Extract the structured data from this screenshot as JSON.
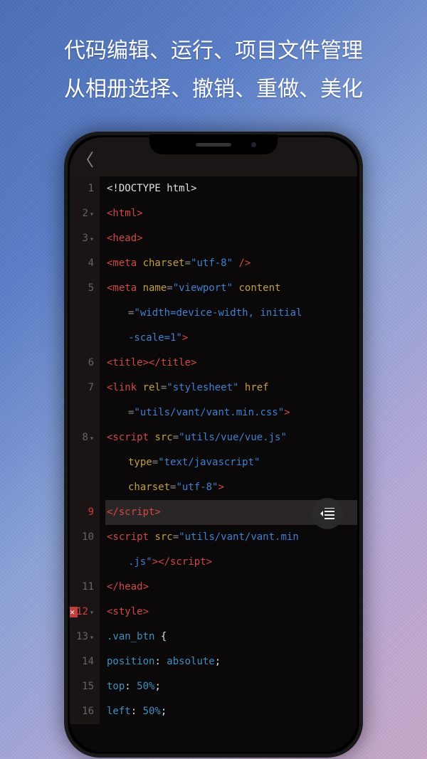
{
  "promo": {
    "line1": "代码编辑、运行、项目文件管理",
    "line2": "从相册选择、撤销、重做、美化"
  },
  "editor": {
    "lines": [
      {
        "num": "1",
        "fold": "",
        "error": false,
        "highlighted": false,
        "indent": 0,
        "tokens": [
          {
            "t": "<!DOCTYPE html>",
            "c": "white"
          }
        ]
      },
      {
        "num": "2",
        "fold": "▾",
        "error": false,
        "highlighted": false,
        "indent": 0,
        "tokens": [
          {
            "t": "<html>",
            "c": "tag"
          }
        ]
      },
      {
        "num": "3",
        "fold": "▾",
        "error": false,
        "highlighted": false,
        "indent": 0,
        "tokens": [
          {
            "t": "<head>",
            "c": "tag"
          }
        ]
      },
      {
        "num": "4",
        "fold": "",
        "error": false,
        "highlighted": false,
        "indent": 0,
        "tokens": [
          {
            "t": "<meta ",
            "c": "tag"
          },
          {
            "t": "charset",
            "c": "attr-name"
          },
          {
            "t": "=",
            "c": "punct"
          },
          {
            "t": "\"utf-8\"",
            "c": "attr-val"
          },
          {
            "t": " />",
            "c": "tag"
          }
        ]
      },
      {
        "num": "5",
        "fold": "",
        "error": false,
        "highlighted": false,
        "indent": 0,
        "tokens": [
          {
            "t": "<meta ",
            "c": "tag"
          },
          {
            "t": "name",
            "c": "attr-name"
          },
          {
            "t": "=",
            "c": "punct"
          },
          {
            "t": "\"viewport\"",
            "c": "attr-val"
          },
          {
            "t": " content",
            "c": "attr-name"
          }
        ]
      },
      {
        "num": "",
        "fold": "",
        "error": false,
        "highlighted": false,
        "indent": 1,
        "tokens": [
          {
            "t": "=",
            "c": "punct"
          },
          {
            "t": "\"width=device-width, initial",
            "c": "attr-val"
          }
        ]
      },
      {
        "num": "",
        "fold": "",
        "error": false,
        "highlighted": false,
        "indent": 1,
        "tokens": [
          {
            "t": "-scale=1\"",
            "c": "attr-val"
          },
          {
            "t": ">",
            "c": "tag"
          }
        ]
      },
      {
        "num": "6",
        "fold": "",
        "error": false,
        "highlighted": false,
        "indent": 0,
        "tokens": [
          {
            "t": "<title></title>",
            "c": "tag"
          }
        ]
      },
      {
        "num": "7",
        "fold": "",
        "error": false,
        "highlighted": false,
        "indent": 0,
        "tokens": [
          {
            "t": "<link ",
            "c": "tag"
          },
          {
            "t": "rel",
            "c": "attr-name"
          },
          {
            "t": "=",
            "c": "punct"
          },
          {
            "t": "\"stylesheet\"",
            "c": "attr-val"
          },
          {
            "t": " href",
            "c": "attr-name"
          }
        ]
      },
      {
        "num": "",
        "fold": "",
        "error": false,
        "highlighted": false,
        "indent": 1,
        "tokens": [
          {
            "t": "=",
            "c": "punct"
          },
          {
            "t": "\"utils/vant/vant.min.css\"",
            "c": "attr-val"
          },
          {
            "t": ">",
            "c": "tag"
          }
        ]
      },
      {
        "num": "8",
        "fold": "▾",
        "error": false,
        "highlighted": false,
        "indent": 0,
        "tokens": [
          {
            "t": "<script ",
            "c": "tag"
          },
          {
            "t": "src",
            "c": "attr-name"
          },
          {
            "t": "=",
            "c": "punct"
          },
          {
            "t": "\"utils/vue/vue.js\"",
            "c": "attr-val"
          }
        ]
      },
      {
        "num": "",
        "fold": "",
        "error": false,
        "highlighted": false,
        "indent": 1,
        "tokens": [
          {
            "t": "type",
            "c": "attr-name"
          },
          {
            "t": "=",
            "c": "punct"
          },
          {
            "t": "\"text/javascript\"",
            "c": "attr-val"
          }
        ]
      },
      {
        "num": "",
        "fold": "",
        "error": false,
        "highlighted": false,
        "indent": 1,
        "tokens": [
          {
            "t": "charset",
            "c": "attr-name"
          },
          {
            "t": "=",
            "c": "punct"
          },
          {
            "t": "\"utf-8\"",
            "c": "attr-val"
          },
          {
            "t": ">",
            "c": "tag"
          }
        ]
      },
      {
        "num": "9",
        "fold": "",
        "error": false,
        "highlighted": true,
        "indent": 0,
        "tokens": [
          {
            "t": "</script>",
            "c": "tag"
          }
        ]
      },
      {
        "num": "10",
        "fold": "",
        "error": false,
        "highlighted": false,
        "indent": 0,
        "tokens": [
          {
            "t": "<script ",
            "c": "tag"
          },
          {
            "t": "src",
            "c": "attr-name"
          },
          {
            "t": "=",
            "c": "punct"
          },
          {
            "t": "\"utils/vant/vant.min",
            "c": "attr-val"
          }
        ]
      },
      {
        "num": "",
        "fold": "",
        "error": false,
        "highlighted": false,
        "indent": 1,
        "tokens": [
          {
            "t": ".js\"",
            "c": "attr-val"
          },
          {
            "t": "></script>",
            "c": "tag"
          }
        ]
      },
      {
        "num": "11",
        "fold": "",
        "error": false,
        "highlighted": false,
        "indent": 0,
        "tokens": [
          {
            "t": "</head>",
            "c": "tag"
          }
        ]
      },
      {
        "num": "12",
        "fold": "▾",
        "error": true,
        "highlighted": false,
        "indent": 0,
        "tokens": [
          {
            "t": "<style>",
            "c": "tag"
          }
        ]
      },
      {
        "num": "13",
        "fold": "▾",
        "error": false,
        "highlighted": false,
        "indent": 0,
        "tokens": [
          {
            "t": ".van_btn",
            "c": "css-sel"
          },
          {
            "t": " {",
            "c": "white"
          }
        ]
      },
      {
        "num": "14",
        "fold": "",
        "error": false,
        "highlighted": false,
        "indent": 0,
        "tokens": [
          {
            "t": "position",
            "c": "css-prop"
          },
          {
            "t": ": ",
            "c": "white"
          },
          {
            "t": "absolute",
            "c": "css-val"
          },
          {
            "t": ";",
            "c": "white"
          }
        ]
      },
      {
        "num": "15",
        "fold": "",
        "error": false,
        "highlighted": false,
        "indent": 0,
        "tokens": [
          {
            "t": "top",
            "c": "css-prop"
          },
          {
            "t": ": ",
            "c": "white"
          },
          {
            "t": "50%",
            "c": "css-val"
          },
          {
            "t": ";",
            "c": "white"
          }
        ]
      },
      {
        "num": "16",
        "fold": "",
        "error": false,
        "highlighted": false,
        "indent": 0,
        "tokens": [
          {
            "t": "left",
            "c": "css-prop"
          },
          {
            "t": ": ",
            "c": "white"
          },
          {
            "t": "50%",
            "c": "css-val"
          },
          {
            "t": ";",
            "c": "white"
          }
        ]
      }
    ],
    "fab_icon": "outdent-icon"
  }
}
